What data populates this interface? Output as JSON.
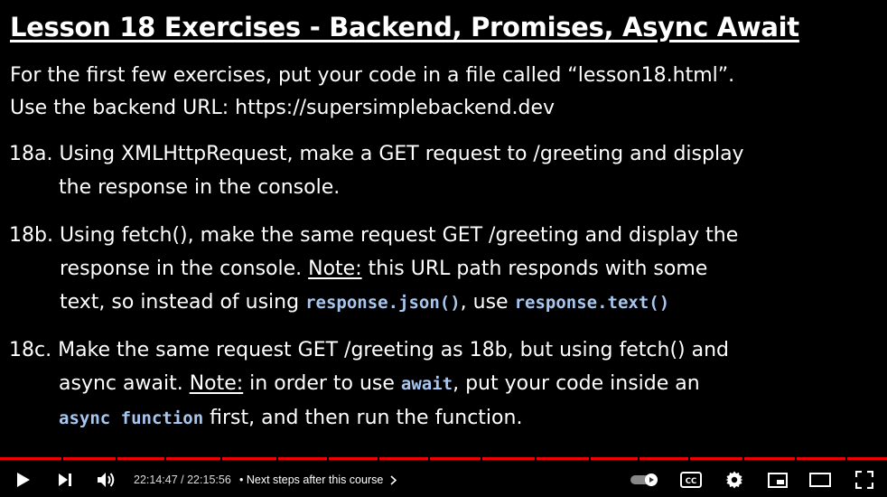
{
  "slide": {
    "title": "Lesson 18 Exercises - Backend, Promises, Async Await",
    "intro": [
      "For the first few exercises, put your code in a file called “lesson18.html”.",
      "Use the backend URL: https://supersimplebackend.dev"
    ],
    "ex18a": {
      "num": "18a.",
      "line1": "Using XMLHttpRequest, make a GET request to /greeting and display",
      "line2": "the response in the console."
    },
    "ex18b": {
      "num": "18b.",
      "line1": "Using fetch(), make the same request GET /greeting and display the",
      "line2_pre": "response in the console.",
      "note": "Note:",
      "line2_post": " this URL path responds with some",
      "line3_pre": "text, so instead of using ",
      "code1": "response.json()",
      "line3_mid": ", use ",
      "code2": "response.text()"
    },
    "ex18c": {
      "num": "18c.",
      "line1": "Make the same request GET /greeting as 18b, but using fetch() and",
      "line2_pre": "async await.",
      "note": "Note:",
      "line2_mid": " in order to use ",
      "code1": "await",
      "line2_post": ", put your code inside an",
      "code2": "async function",
      "line3_post": " first, and then run the function."
    }
  },
  "player": {
    "current_time": "22:14:47",
    "duration": "22:15:56",
    "chapter": "Next steps after this course",
    "progress_fraction": 0.999,
    "icons": {
      "play": "play-icon",
      "next": "next-icon",
      "volume": "volume-icon",
      "autoplay": "autoplay-toggle-icon",
      "captions": "captions-icon",
      "settings": "settings-gear-icon",
      "miniplayer": "miniplayer-icon",
      "theater": "theater-mode-icon",
      "fullscreen": "fullscreen-icon"
    },
    "captions_label": "CC",
    "accent_color": "#ff0000"
  }
}
